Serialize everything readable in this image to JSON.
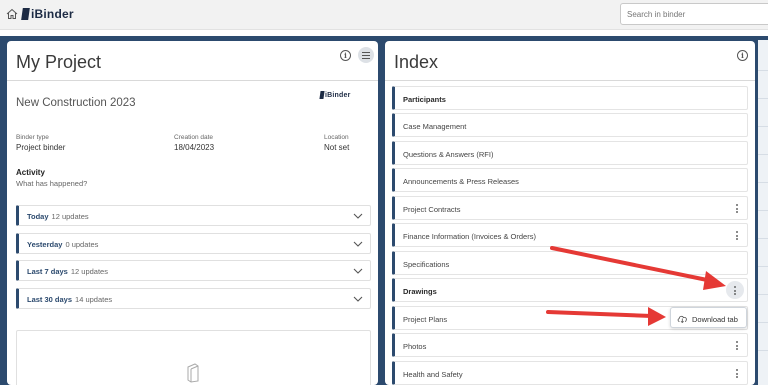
{
  "topbar": {
    "brand": "iBinder",
    "search_placeholder": "Search in binder"
  },
  "left_panel": {
    "title": "My Project",
    "project_name": "New Construction 2023",
    "small_brand": "iBinder",
    "meta": [
      {
        "label": "Binder type",
        "value": "Project binder"
      },
      {
        "label": "Creation date",
        "value": "18/04/2023"
      },
      {
        "label": "Location",
        "value": "Not set"
      }
    ],
    "activity_title": "Activity",
    "activity_subtitle": "What has happened?",
    "activity_rows": [
      {
        "label": "Today",
        "count": "12 updates"
      },
      {
        "label": "Yesterday",
        "count": "0 updates"
      },
      {
        "label": "Last 7 days",
        "count": "12 updates"
      },
      {
        "label": "Last 30 days",
        "count": "14 updates"
      }
    ]
  },
  "right_panel": {
    "title": "Index",
    "items": [
      {
        "label": "Participants",
        "bold": true,
        "menu": "none"
      },
      {
        "label": "Case Management",
        "bold": false,
        "menu": "none"
      },
      {
        "label": "Questions & Answers (RFI)",
        "bold": false,
        "menu": "none"
      },
      {
        "label": "Announcements & Press Releases",
        "bold": false,
        "menu": "none"
      },
      {
        "label": "Project Contracts",
        "bold": false,
        "menu": "kebab"
      },
      {
        "label": "Finance Information (Invoices & Orders)",
        "bold": false,
        "menu": "kebab"
      },
      {
        "label": "Specifications",
        "bold": false,
        "menu": "none"
      },
      {
        "label": "Drawings",
        "bold": true,
        "menu": "kebab-active"
      },
      {
        "label": "Project Plans",
        "bold": false,
        "menu": "none"
      },
      {
        "label": "Photos",
        "bold": false,
        "menu": "kebab"
      },
      {
        "label": "Health and Safety",
        "bold": false,
        "menu": "kebab"
      }
    ],
    "popup": {
      "icon": "cloud-download-icon",
      "label": "Download tab"
    }
  },
  "colors": {
    "frame": "#2c4a6e",
    "accent": "#2c4a6e",
    "arrow": "#e53935"
  }
}
